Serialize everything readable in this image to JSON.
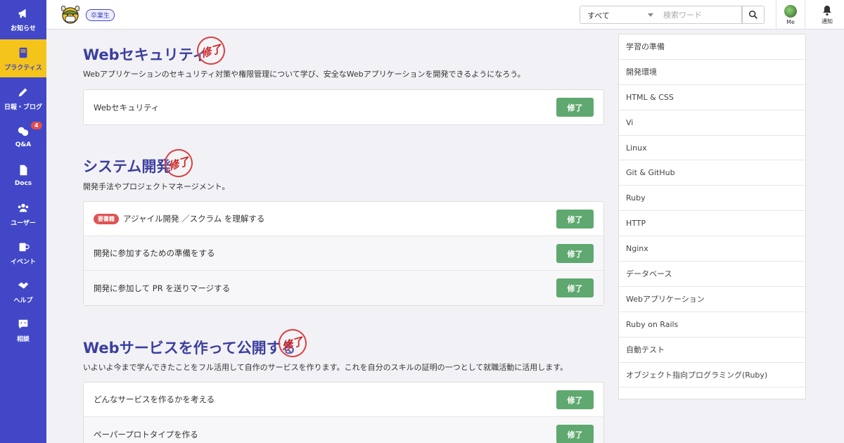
{
  "sidebar": {
    "items": [
      {
        "label": "お知らせ",
        "icon": "megaphone-icon"
      },
      {
        "label": "プラクティス",
        "icon": "book-icon",
        "active": true
      },
      {
        "label": "日報・ブログ",
        "icon": "pencil-icon"
      },
      {
        "label": "Q&A",
        "icon": "chat-icon",
        "badge": "4"
      },
      {
        "label": "Docs",
        "icon": "document-icon"
      },
      {
        "label": "ユーザー",
        "icon": "users-icon"
      },
      {
        "label": "イベント",
        "icon": "mug-icon"
      },
      {
        "label": "ヘルプ",
        "icon": "handshake-icon"
      },
      {
        "label": "相談",
        "icon": "comment-icon"
      }
    ]
  },
  "header": {
    "badge": "卒業生",
    "search_select": "すべて",
    "search_placeholder": "検索ワード",
    "me_label": "Me",
    "notif_label": "通知"
  },
  "sections": [
    {
      "title": "Webセキュリティ",
      "stamp": "修了",
      "description": "Webアプリケーションのセキュリティ対策や権限管理について学び、安全なWebアプリケーションを開発できるようになろう。",
      "practices": [
        {
          "label": "Webセキュリティ",
          "button": "修了"
        }
      ]
    },
    {
      "title": "システム開発",
      "stamp": "修了",
      "description": "開発手法やプロジェクトマネージメント。",
      "practices": [
        {
          "label": "アジャイル開発 ／スクラム を理解する",
          "badge": "要書籍",
          "button": "修了"
        },
        {
          "label": "開発に参加するための準備をする",
          "button": "修了"
        },
        {
          "label": "開発に参加して PR を送りマージする",
          "button": "修了"
        }
      ]
    },
    {
      "title": "Webサービスを作って公開する",
      "stamp": "修了",
      "description": "いよいよ今まで学んできたことをフル活用して自作のサービスを作ります。これを自分のスキルの証明の一つとして就職活動に活用します。",
      "practices": [
        {
          "label": "どんなサービスを作るかを考える",
          "button": "修了"
        },
        {
          "label": "ペーパープロトタイプを作る",
          "button": "修了"
        }
      ]
    }
  ],
  "category_nav": [
    "学習の準備",
    "開発環境",
    "HTML & CSS",
    "Vi",
    "Linux",
    "Git & GitHub",
    "Ruby",
    "HTTP",
    "Nginx",
    "データベース",
    "Webアプリケーション",
    "Ruby on Rails",
    "自動テスト",
    "オブジェクト指向プログラミング(Ruby)"
  ],
  "colors": {
    "sidebar": "#4147c7",
    "active_item": "#f5c41a",
    "title": "#3c3f9e",
    "done_button": "#5fa870",
    "stamp": "#d94040"
  }
}
